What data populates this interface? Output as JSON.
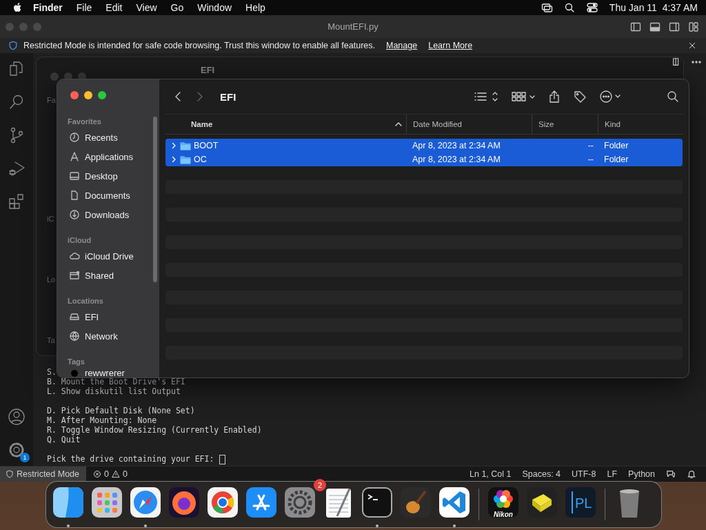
{
  "menu_bar": {
    "app": "Finder",
    "menus": [
      "File",
      "Edit",
      "View",
      "Go",
      "Window",
      "Help"
    ],
    "clock": "Thu Jan 11  4:37 AM"
  },
  "editor_window": {
    "title": "MountEFI.py",
    "banner": {
      "text": "Restricted Mode is intended for safe code browsing. Trust this window to enable all features.",
      "links": [
        "Manage",
        "Learn More"
      ]
    },
    "settings_badge": "1",
    "terminal_blocks": [
      [
        "S.",
        "B. Mount the Boot Drive's EFI",
        "L. Show diskutil list Output"
      ],
      [
        "D. Pick Default Disk (None Set)",
        "M. After Mounting: None",
        "R. Toggle Window Resizing (Currently Enabled)",
        "Q. Quit"
      ],
      [
        "Pick the drive containing your EFI:"
      ]
    ],
    "status_bar": {
      "mode": "Restricted Mode",
      "errors": "0",
      "warnings": "0",
      "items": [
        "Ln 1, Col 1",
        "Spaces: 4",
        "UTF-8",
        "LF",
        "Python"
      ]
    }
  },
  "background_window": {
    "title": "EFI",
    "sidebar_fragments": [
      "Fa",
      "iC",
      "Lo",
      "Ta"
    ]
  },
  "finder": {
    "title": "EFI",
    "sidebar": [
      {
        "heading": "Favorites",
        "items": [
          {
            "label": "Recents",
            "kind": "clock"
          },
          {
            "label": "Applications",
            "kind": "apps"
          },
          {
            "label": "Desktop",
            "kind": "desktop"
          },
          {
            "label": "Documents",
            "kind": "document"
          },
          {
            "label": "Downloads",
            "kind": "download"
          }
        ]
      },
      {
        "heading": "iCloud",
        "items": [
          {
            "label": "iCloud Drive",
            "kind": "cloud"
          },
          {
            "label": "Shared",
            "kind": "shared"
          }
        ]
      },
      {
        "heading": "Locations",
        "items": [
          {
            "label": "EFI",
            "kind": "drive"
          },
          {
            "label": "Network",
            "kind": "globe"
          }
        ]
      },
      {
        "heading": "Tags",
        "items": [
          {
            "label": "rewwrerer",
            "kind": "tag",
            "color": "#000000"
          }
        ]
      }
    ],
    "columns": [
      {
        "label": "Name",
        "sorted": true
      },
      {
        "label": "Date Modified",
        "sorted": false
      },
      {
        "label": "Size",
        "sorted": false
      },
      {
        "label": "Kind",
        "sorted": false
      }
    ],
    "rows": [
      {
        "name": "BOOT",
        "date": "Apr 8, 2023 at 2:34 AM",
        "size": "--",
        "kind": "Folder",
        "selected": true
      },
      {
        "name": "OC",
        "date": "Apr 8, 2023 at 2:34 AM",
        "size": "--",
        "kind": "Folder",
        "selected": true
      }
    ]
  },
  "dock": {
    "items": [
      {
        "kind": "finder",
        "running": true
      },
      {
        "kind": "launchpad",
        "running": false
      },
      {
        "kind": "safari",
        "running": true
      },
      {
        "kind": "firefox",
        "running": false
      },
      {
        "kind": "chrome",
        "running": false
      },
      {
        "kind": "appstore",
        "running": false
      },
      {
        "kind": "settings",
        "running": false,
        "badge": "2"
      },
      {
        "kind": "textedit",
        "running": false
      },
      {
        "kind": "terminal",
        "running": true
      },
      {
        "kind": "garageband",
        "running": false
      },
      {
        "kind": "vscode",
        "running": true
      },
      {
        "kind": "separator"
      },
      {
        "kind": "nikon",
        "running": false,
        "label": "Nikon"
      },
      {
        "kind": "cube",
        "running": false
      },
      {
        "kind": "pl",
        "running": false,
        "label": "PL"
      },
      {
        "kind": "separator"
      },
      {
        "kind": "trash",
        "running": false
      }
    ]
  }
}
